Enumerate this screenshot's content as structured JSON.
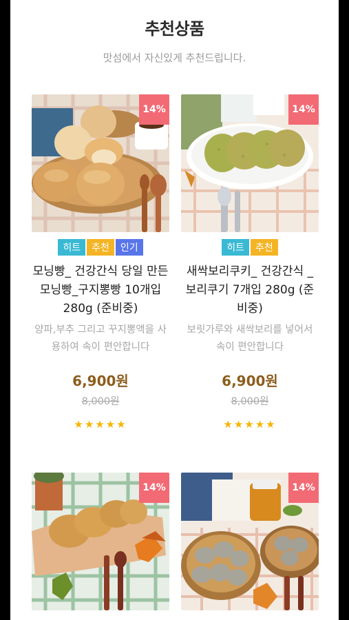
{
  "section": {
    "title": "추천상품",
    "subtitle": "맛섬에서 자신있게 추천드립니다."
  },
  "products": [
    {
      "discount": "14%",
      "tags": [
        "히트",
        "추천",
        "인기"
      ],
      "name": "모닝빵_ 건강간식 당일 만든 모닝빵_구지뽕빵 10개입 280g (준비중)",
      "description": "양파,부추 그리고 꾸지뽕액을 사용하여 속이 편안합니다",
      "price": "6,900원",
      "original_price": "8,000원",
      "rating": "★★★★★",
      "image_icon": "morning-bread-photo"
    },
    {
      "discount": "14%",
      "tags": [
        "히트",
        "추천"
      ],
      "name": "새싹보리쿠키_ 건강간식 _ 보리쿠기 7개입 280g (준비중)",
      "description": "보릿가루와 새싹보리를 넣어서 속이 편안합니다",
      "price": "6,900원",
      "original_price": "8,000원",
      "rating": "★★★★★",
      "image_icon": "barley-cookie-photo"
    },
    {
      "discount": "14%",
      "tags": [],
      "image_icon": "pancake-photo"
    },
    {
      "discount": "14%",
      "tags": [],
      "image_icon": "rice-cake-photo"
    }
  ],
  "colors": {
    "discount_bg": "#f26a74",
    "tag_hit": "#39b9d3",
    "tag_recommend": "#f4b425",
    "tag_popular": "#5975ea",
    "price": "#8c5d1c",
    "star": "#f6b500"
  }
}
